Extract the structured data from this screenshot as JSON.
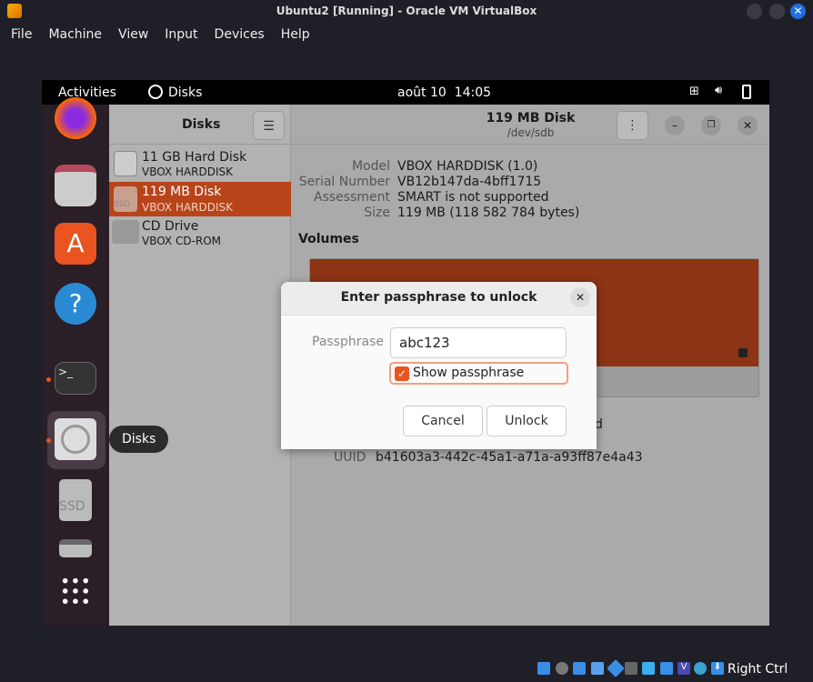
{
  "window": {
    "title": "Ubuntu2 [Running] - Oracle VM VirtualBox"
  },
  "menu": [
    "File",
    "Machine",
    "View",
    "Input",
    "Devices",
    "Help"
  ],
  "topbar": {
    "activities": "Activities",
    "app": "Disks",
    "clock": "août 10  14:05"
  },
  "dock": {
    "tooltip": "Disks",
    "icons": [
      "firefox-icon",
      "files-icon",
      "software-icon",
      "help-icon",
      "terminal-icon",
      "disks-icon",
      "ssd-lock-icon",
      "drive-icon",
      "app-grid-icon"
    ]
  },
  "sidebar": {
    "title": "Disks",
    "items": [
      {
        "name": "11 GB Hard Disk",
        "sub": "VBOX HARDDISK",
        "selected": false
      },
      {
        "name": "119 MB Disk",
        "sub": "VBOX HARDDISK",
        "selected": true
      },
      {
        "name": "CD Drive",
        "sub": "VBOX CD-ROM",
        "selected": false
      }
    ]
  },
  "main": {
    "title": "119 MB Disk",
    "subtitle": "/dev/sdb",
    "props": [
      {
        "k": "Model",
        "v": "VBOX HARDDISK (1.0)"
      },
      {
        "k": "Serial Number",
        "v": "VB12b147da-4bff1715"
      },
      {
        "k": "Assessment",
        "v": "SMART is not supported"
      },
      {
        "k": "Size",
        "v": "119 MB (118 582 784 bytes)"
      }
    ],
    "volumes": "Volumes",
    "uuid_label": "UUID",
    "uuid": "b41603a3-442c-45a1-a71a-a93ff87e4a43",
    "partial_text": "d"
  },
  "dialog": {
    "title": "Enter passphrase to unlock",
    "label": "Passphrase",
    "value": "abc123",
    "show": "Show passphrase",
    "checked": true,
    "cancel": "Cancel",
    "unlock": "Unlock"
  },
  "statusbar": {
    "host_key": "Right Ctrl"
  },
  "colors": {
    "accent": "#e95420",
    "volume": "#8c3414"
  }
}
